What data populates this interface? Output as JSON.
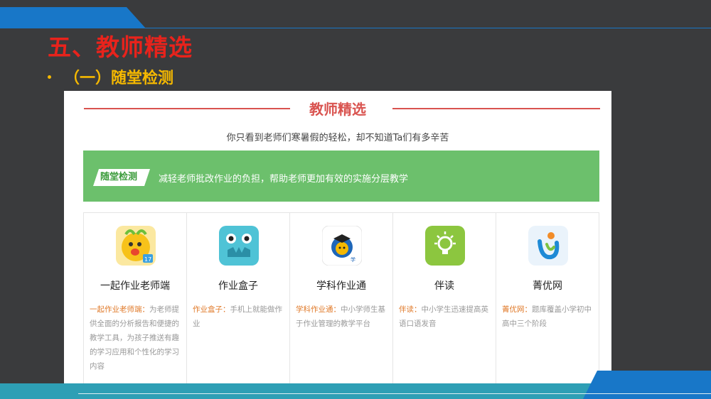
{
  "slide": {
    "title": "五、教师精选",
    "subtitle": "（一）随堂检测"
  },
  "card": {
    "title": "教师精选",
    "subtitle": "你只看到老师们寒暑假的轻松，却不知道Ta们有多辛苦",
    "tag": "随堂检测",
    "band_text": "减轻老师批改作业的负担，帮助老师更加有效的实施分层教学"
  },
  "tools": [
    {
      "name": "一起作业老师端",
      "desc_label": "一起作业老师端：",
      "desc_text": "为老师提供全面的分析报告和便捷的教学工具，为孩子推送有趣的学习应用和个性化的学习内容",
      "icon": "yiqi-zuoye-icon",
      "color": "#f7c21a"
    },
    {
      "name": "作业盒子",
      "desc_label": "作业盒子：",
      "desc_text": "手机上就能做作业",
      "icon": "zuoye-hezi-icon",
      "color": "#4fc3d6"
    },
    {
      "name": "学科作业通",
      "desc_label": "学科作业通：",
      "desc_text": "中小学师生基于作业管理的教学平台",
      "icon": "xueke-zuoyetong-icon",
      "color": "#ffffff"
    },
    {
      "name": "伴读",
      "desc_label": "伴读：",
      "desc_text": "中小学生迅速提高英语口语发音",
      "icon": "bandu-lightbulb-icon",
      "color": "#8cc63f"
    },
    {
      "name": "菁优网",
      "desc_label": "菁优网：",
      "desc_text": "题库覆盖小学初中高中三个阶段",
      "icon": "jingyou-icon",
      "color": "#eaf3fb"
    }
  ]
}
